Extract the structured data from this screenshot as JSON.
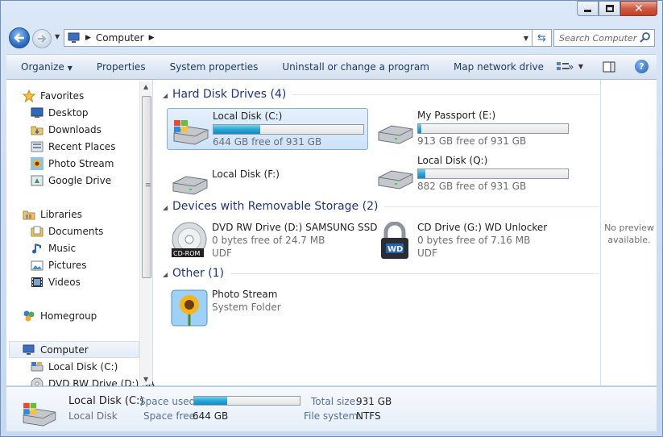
{
  "window": {
    "minimize_label": "",
    "maximize_label": "",
    "close_label": "✕"
  },
  "address": {
    "location": "Computer",
    "search_placeholder": "Search Computer"
  },
  "toolbar": {
    "organize": "Organize",
    "properties": "Properties",
    "system_properties": "System properties",
    "uninstall": "Uninstall or change a program",
    "map_network_drive": "Map network drive",
    "more": "»",
    "help": "?"
  },
  "nav": {
    "favorites": "Favorites",
    "desktop": "Desktop",
    "downloads": "Downloads",
    "recent_places": "Recent Places",
    "photo_stream": "Photo Stream",
    "google_drive": "Google Drive",
    "libraries": "Libraries",
    "documents": "Documents",
    "music": "Music",
    "pictures": "Pictures",
    "videos": "Videos",
    "homegroup": "Homegroup",
    "computer": "Computer",
    "local_disk_c": "Local Disk (C:)",
    "dvd_drive": "DVD RW Drive (D:) SA"
  },
  "groups": {
    "hard_disks": "Hard Disk Drives (4)",
    "removable": "Devices with Removable Storage (2)",
    "other": "Other (1)"
  },
  "drives": {
    "c": {
      "name": "Local Disk (C:)",
      "free": "644 GB free of 931 GB",
      "used_fraction": 0.31
    },
    "e": {
      "name": "My Passport (E:)",
      "free": "913 GB free of 931 GB",
      "used_fraction": 0.02
    },
    "f": {
      "name": "Local Disk (F:)"
    },
    "q": {
      "name": "Local Disk (Q:)",
      "free": "882 GB free of 931 GB",
      "used_fraction": 0.05
    },
    "d": {
      "name": "DVD RW Drive (D:) SAMSUNG SSD",
      "free": "0 bytes free of 24.7 MB",
      "fs": "UDF"
    },
    "g": {
      "name": "CD Drive (G:) WD Unlocker",
      "free": "0 bytes free of 7.16 MB",
      "fs": "UDF"
    }
  },
  "other": {
    "photo_stream": {
      "name": "Photo Stream",
      "type": "System Folder"
    }
  },
  "preview": {
    "text": "No preview available."
  },
  "details": {
    "name": "Local Disk (C:)",
    "type": "Local Disk",
    "space_used_label": "Space used:",
    "space_free_label": "Space free:",
    "space_free": "644 GB",
    "total_size_label": "Total size:",
    "total_size": "931 GB",
    "file_system_label": "File system:",
    "file_system": "NTFS",
    "used_fraction": 0.31
  },
  "colors": {
    "accent_header": "#1e3287",
    "bar_fill": "#27a7d8"
  }
}
